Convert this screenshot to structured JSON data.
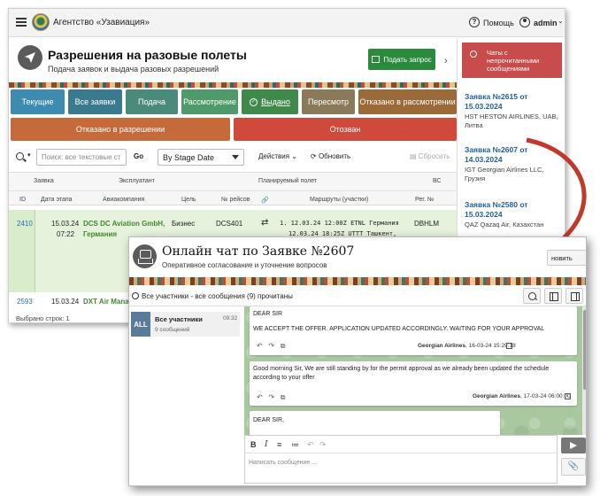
{
  "header": {
    "brand": "Агентство «Узавиация»",
    "help_label": "Помощь",
    "user_name": "admin"
  },
  "page": {
    "title": "Разрешения на разовые полеты",
    "subtitle": "Подача заявок и выдача разовых разрешений",
    "submit_label": "Подать запрос"
  },
  "tabs": [
    {
      "label": "Текущие",
      "color": "#3d8bb0"
    },
    {
      "label": "Все заявки",
      "color": "#3a7a8f"
    },
    {
      "label": "Подача",
      "color": "#4a8a7a"
    },
    {
      "label": "Рассмотрение",
      "color": "#4f9a6a"
    },
    {
      "label": "Выдано",
      "color": "#3f8a4a"
    },
    {
      "label": "Пересмотр",
      "color": "#8a7a5a"
    },
    {
      "label": "Отказано в рассмотрении",
      "color": "#9a6a38"
    }
  ],
  "status_row": [
    {
      "label": "Отказано в разрешении",
      "color": "#c56a3a"
    },
    {
      "label": "Отозван",
      "color": "#cf4a3a"
    }
  ],
  "toolbar": {
    "search_placeholder": "Поиск: все текстовые ст",
    "go_label": "Go",
    "stage_select": "By Stage Date",
    "actions_label": "Действия",
    "refresh_label": "Обновить",
    "reset_label": "Сбросить"
  },
  "table": {
    "groups": [
      "Заявка",
      "Эксплуатант",
      "Планируемый полет",
      "ВС"
    ],
    "columns": [
      "ID",
      "Дата этапа",
      "Авиакомпания",
      "Цель",
      "№ рейсов",
      "Маршруты (участки)",
      "Рег. №"
    ],
    "rows": [
      {
        "id": "2410",
        "date": "15.03.24",
        "time": "07:22",
        "airline": "DCS DC Aviation GmbH,",
        "country": "Германия",
        "purpose": "Бизнес",
        "flight": "DCS401",
        "route1": "1. 12.03.24 12:00Z ETNL Германия",
        "route2": "12.03.24 18:25Z UTTT Ташкент,",
        "reg": "DBHLM"
      },
      {
        "id": "2593",
        "date": "15.03.24",
        "airline": "DXT Air Manag"
      }
    ],
    "footer": "Выбрано строк: 1"
  },
  "sidebar": {
    "alert": "Чаты с непрочитанными сообщениями",
    "items": [
      {
        "title": "Заявка №2615 от 15.03.2024",
        "desc": "HST HESTON AIRLINES, UAB, Литва"
      },
      {
        "title": "Заявка №2607 от 14.03.2024",
        "desc": "IGT Georgian Airlines LLC, Грузия"
      },
      {
        "title": "Заявка №2580 от 15.03.2024",
        "desc": "QAZ Qazaq Air, Казахстан"
      }
    ]
  },
  "chat": {
    "title": "Онлайн чат по Заявке №2607",
    "subtitle": "Оперативное согласование и уточнение вопросов",
    "close_label": "новить",
    "bar_label": "Все участники - все сообщения (9) прочитаны",
    "room": {
      "avatar": "ALL",
      "name": "Все участники",
      "count": "9 сообщений",
      "time": "09:32"
    },
    "messages": [
      {
        "line1": "DEAR SIR",
        "line2": "WE ACCEPT THE OFFER. APPLICATION UPDATED ACCORDINGLY. WAITING FOR YOUR APPROVAL",
        "sender": "Georgian Airlines",
        "time": "16-03-24 15:29:18"
      },
      {
        "line1": "Good morning Sir, We are still standing by for the permit approval as we already been updated the schedule according to your offer",
        "sender": "Georgian Airlines",
        "time": "17-03-24 06:00:00"
      },
      {
        "line1": "DEAR SIR,"
      }
    ],
    "composer_placeholder": "Написать сообщение ..."
  }
}
